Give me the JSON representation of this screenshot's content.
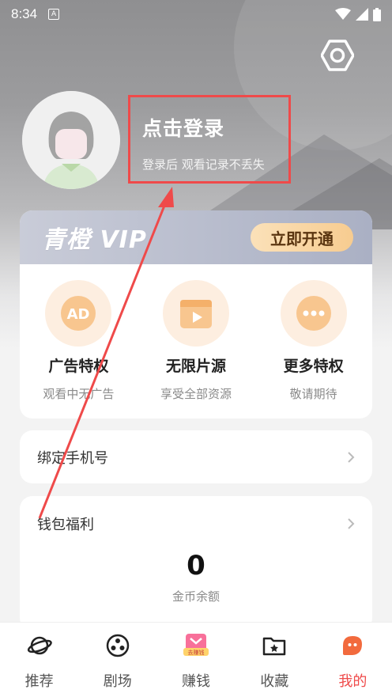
{
  "status_bar": {
    "time": "8:34",
    "notif_letter": "A"
  },
  "header": {
    "settings_icon": "hexagon-gear-icon"
  },
  "profile": {
    "login_title": "点击登录",
    "login_subtitle": "登录后 观看记录不丢失"
  },
  "vip": {
    "logo_text": "青橙 VIP",
    "open_button": "立即开通",
    "perks": [
      {
        "icon": "ad-icon",
        "title": "广告特权",
        "desc": "观看中无广告"
      },
      {
        "icon": "clapperboard-play-icon",
        "title": "无限片源",
        "desc": "享受全部资源"
      },
      {
        "icon": "more-dots-icon",
        "title": "更多特权",
        "desc": "敬请期待"
      }
    ]
  },
  "bind_phone": {
    "label": "绑定手机号"
  },
  "wallet": {
    "label": "钱包福利",
    "coin_amount": "0",
    "coin_label": "金币余额"
  },
  "bottom_nav": [
    {
      "icon": "planet-icon",
      "label": "推荐"
    },
    {
      "icon": "film-reel-icon",
      "label": "剧场"
    },
    {
      "icon": "earn-money-icon",
      "label": "赚钱",
      "badge": "去赚钱"
    },
    {
      "icon": "folder-star-icon",
      "label": "收藏"
    },
    {
      "icon": "mine-face-icon",
      "label": "我的",
      "active": true
    }
  ],
  "colors": {
    "accent": "#ef4a4a",
    "vip_gold": "#f7cc90",
    "perk_bg": "#fdeee0"
  }
}
